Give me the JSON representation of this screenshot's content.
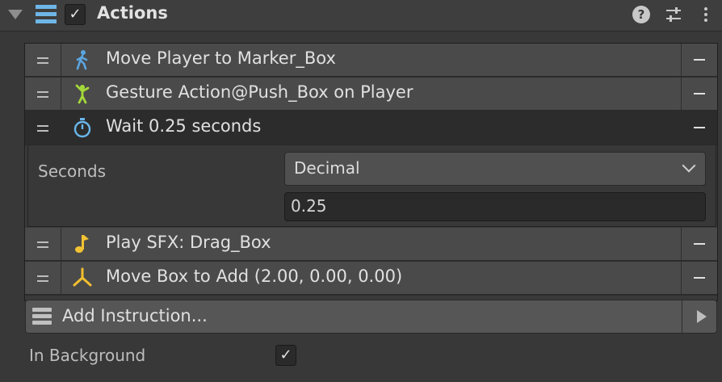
{
  "header": {
    "title": "Actions",
    "enabled_checkbox": "✓",
    "help_icon": "?"
  },
  "instructions": [
    {
      "label": "Move Player to Marker_Box",
      "icon": "walking-person-icon",
      "icon_color": "#5aa6e0"
    },
    {
      "label": "Gesture Action@Push_Box on Player",
      "icon": "gesture-person-icon",
      "icon_color": "#a4d93a"
    },
    {
      "label": "Wait 0.25 seconds",
      "icon": "stopwatch-icon",
      "icon_color": "#69b6ea",
      "selected": true
    },
    {
      "label": "Play SFX: Drag_Box",
      "icon": "music-note-icon",
      "icon_color": "#f1c232"
    },
    {
      "label": "Move Box to Add (2.00, 0.00, 0.00)",
      "icon": "transform-axes-icon",
      "icon_color": "#f3bf2f"
    }
  ],
  "wait_details": {
    "seconds_label": "Seconds",
    "type_value": "Decimal",
    "value": "0.25"
  },
  "add_instruction": {
    "label": "Add Instruction..."
  },
  "background": {
    "label": "In Background",
    "checked": "✓"
  }
}
